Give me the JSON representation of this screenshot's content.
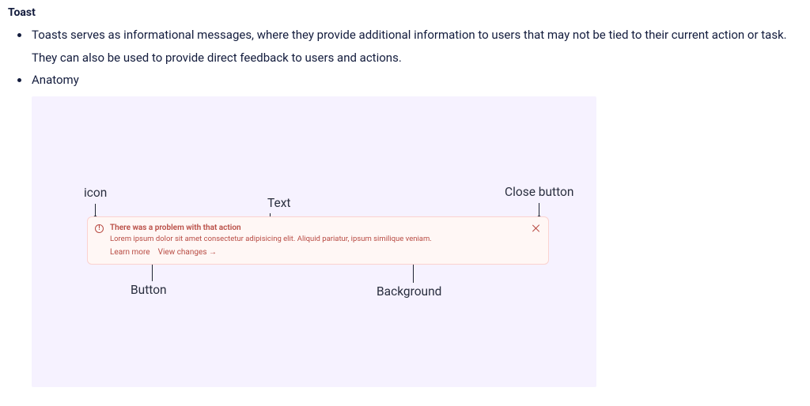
{
  "heading": "Toast",
  "bullets": [
    "Toasts serves as informational messages, where they provide additional information to users that may not be tied to their current action or task. They can also be used to provide direct feedback to users and actions.",
    "Anatomy"
  ],
  "anatomy_labels": {
    "icon": "icon",
    "text": "Text",
    "close": "Close button",
    "button": "Button",
    "background": "Background"
  },
  "toast": {
    "title": "There was a problem with that action",
    "body": "Lorem ipsum dolor sit amet consectetur adipisicing elit. Aliquid pariatur, ipsum similique veniam.",
    "learn_more": "Learn more",
    "view_changes": "View changes",
    "arrow": "→"
  }
}
